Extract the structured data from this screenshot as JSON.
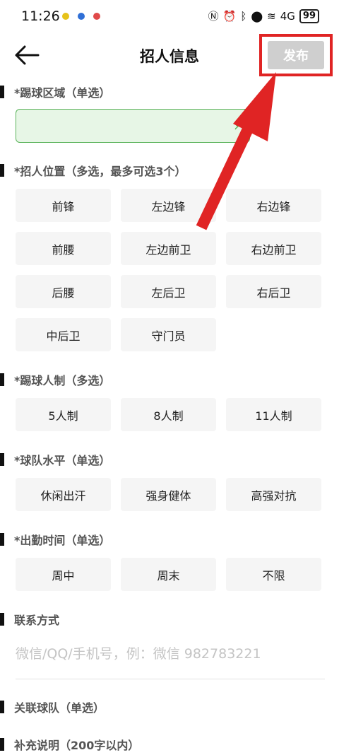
{
  "status_bar": {
    "time": "11:26",
    "signal_text": "4G",
    "battery": "99"
  },
  "header": {
    "title": "招人信息",
    "publish_label": "发布"
  },
  "sections": {
    "area": {
      "label": "*踢球区域（单选）"
    },
    "positions": {
      "label": "*招人位置（多选，最多可选3个）",
      "options": [
        "前锋",
        "左边锋",
        "右边锋",
        "前腰",
        "左边前卫",
        "右边前卫",
        "后腰",
        "左后卫",
        "右后卫",
        "中后卫",
        "守门员"
      ]
    },
    "format": {
      "label": "*踢球人制（多选）",
      "options": [
        "5人制",
        "8人制",
        "11人制"
      ]
    },
    "level": {
      "label": "*球队水平（单选）",
      "options": [
        "休闲出汗",
        "强身健体",
        "高强对抗"
      ]
    },
    "time": {
      "label": "*出勤时间（单选）",
      "options": [
        "周中",
        "周末",
        "不限"
      ]
    },
    "contact": {
      "label": "联系方式",
      "placeholder": "微信/QQ/手机号，例：微信 982783221"
    },
    "team": {
      "label": "关联球队（单选）"
    },
    "notes": {
      "label": "补充说明（200字以内）"
    }
  },
  "colors": {
    "accent_green": "#5ab35a",
    "highlight_red": "#e02424",
    "chip_bg": "#f5f5f5"
  }
}
